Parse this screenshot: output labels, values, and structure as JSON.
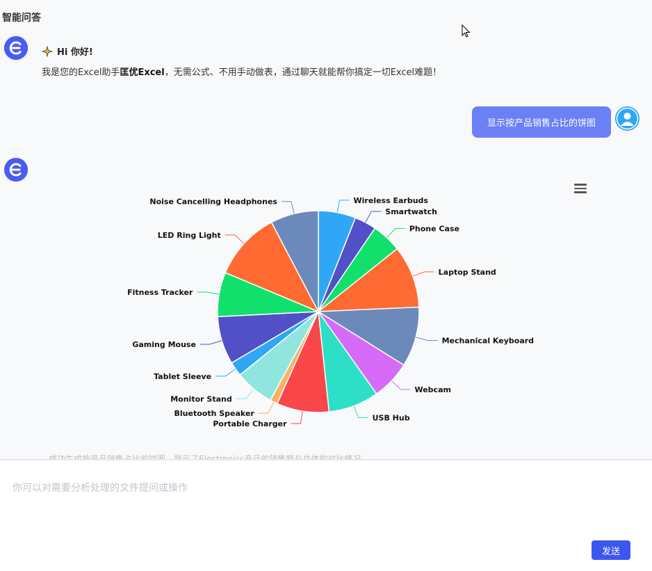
{
  "app": {
    "title": "智能问答"
  },
  "greeting": {
    "title": "Hi 你好!",
    "text_before": "我是您的Excel助手",
    "brand": "匡优Excel",
    "text_after": "，无需公式、不用手动做表，通过聊天就能帮你搞定一切Excel难题！"
  },
  "user_message": "显示按产品销售占比的饼图",
  "faded_text": "成功生成按产品销售占比的饼图，展示了Electronics产品的销售额与总体的对比情况",
  "input": {
    "placeholder": "你可以对需要分析处理的文件提问或操作",
    "value": ""
  },
  "send_label": "发送",
  "colors": {
    "accent": "#3b57f0",
    "bubble": "#6b80f5"
  },
  "chart_data": {
    "type": "pie",
    "labels": [
      "Wireless Earbuds",
      "Smartwatch",
      "Phone Case",
      "Laptop Stand",
      "Mechanical Keyboard",
      "Webcam",
      "USB Hub",
      "Portable Charger",
      "Bluetooth Speaker",
      "Monitor Stand",
      "Tablet Sleeve",
      "Gaming Mouse",
      "Fitness Tracker",
      "LED Ring Light",
      "Noise Cancelling Headphones"
    ],
    "values": [
      6.0,
      3.5,
      4.8,
      10.0,
      9.6,
      6.3,
      8.1,
      8.4,
      1.2,
      6.3,
      2.3,
      7.7,
      7.1,
      11.0,
      7.7
    ],
    "colors": [
      "#2fa7f5",
      "#5150c6",
      "#12e06c",
      "#ff6a32",
      "#6b89ba",
      "#d66bf8",
      "#2ddfc6",
      "#f9474a",
      "#f8b266",
      "#90e6de",
      "#2fa7f5",
      "#5150c6",
      "#12e06c",
      "#ff6a32",
      "#6b89ba"
    ]
  }
}
